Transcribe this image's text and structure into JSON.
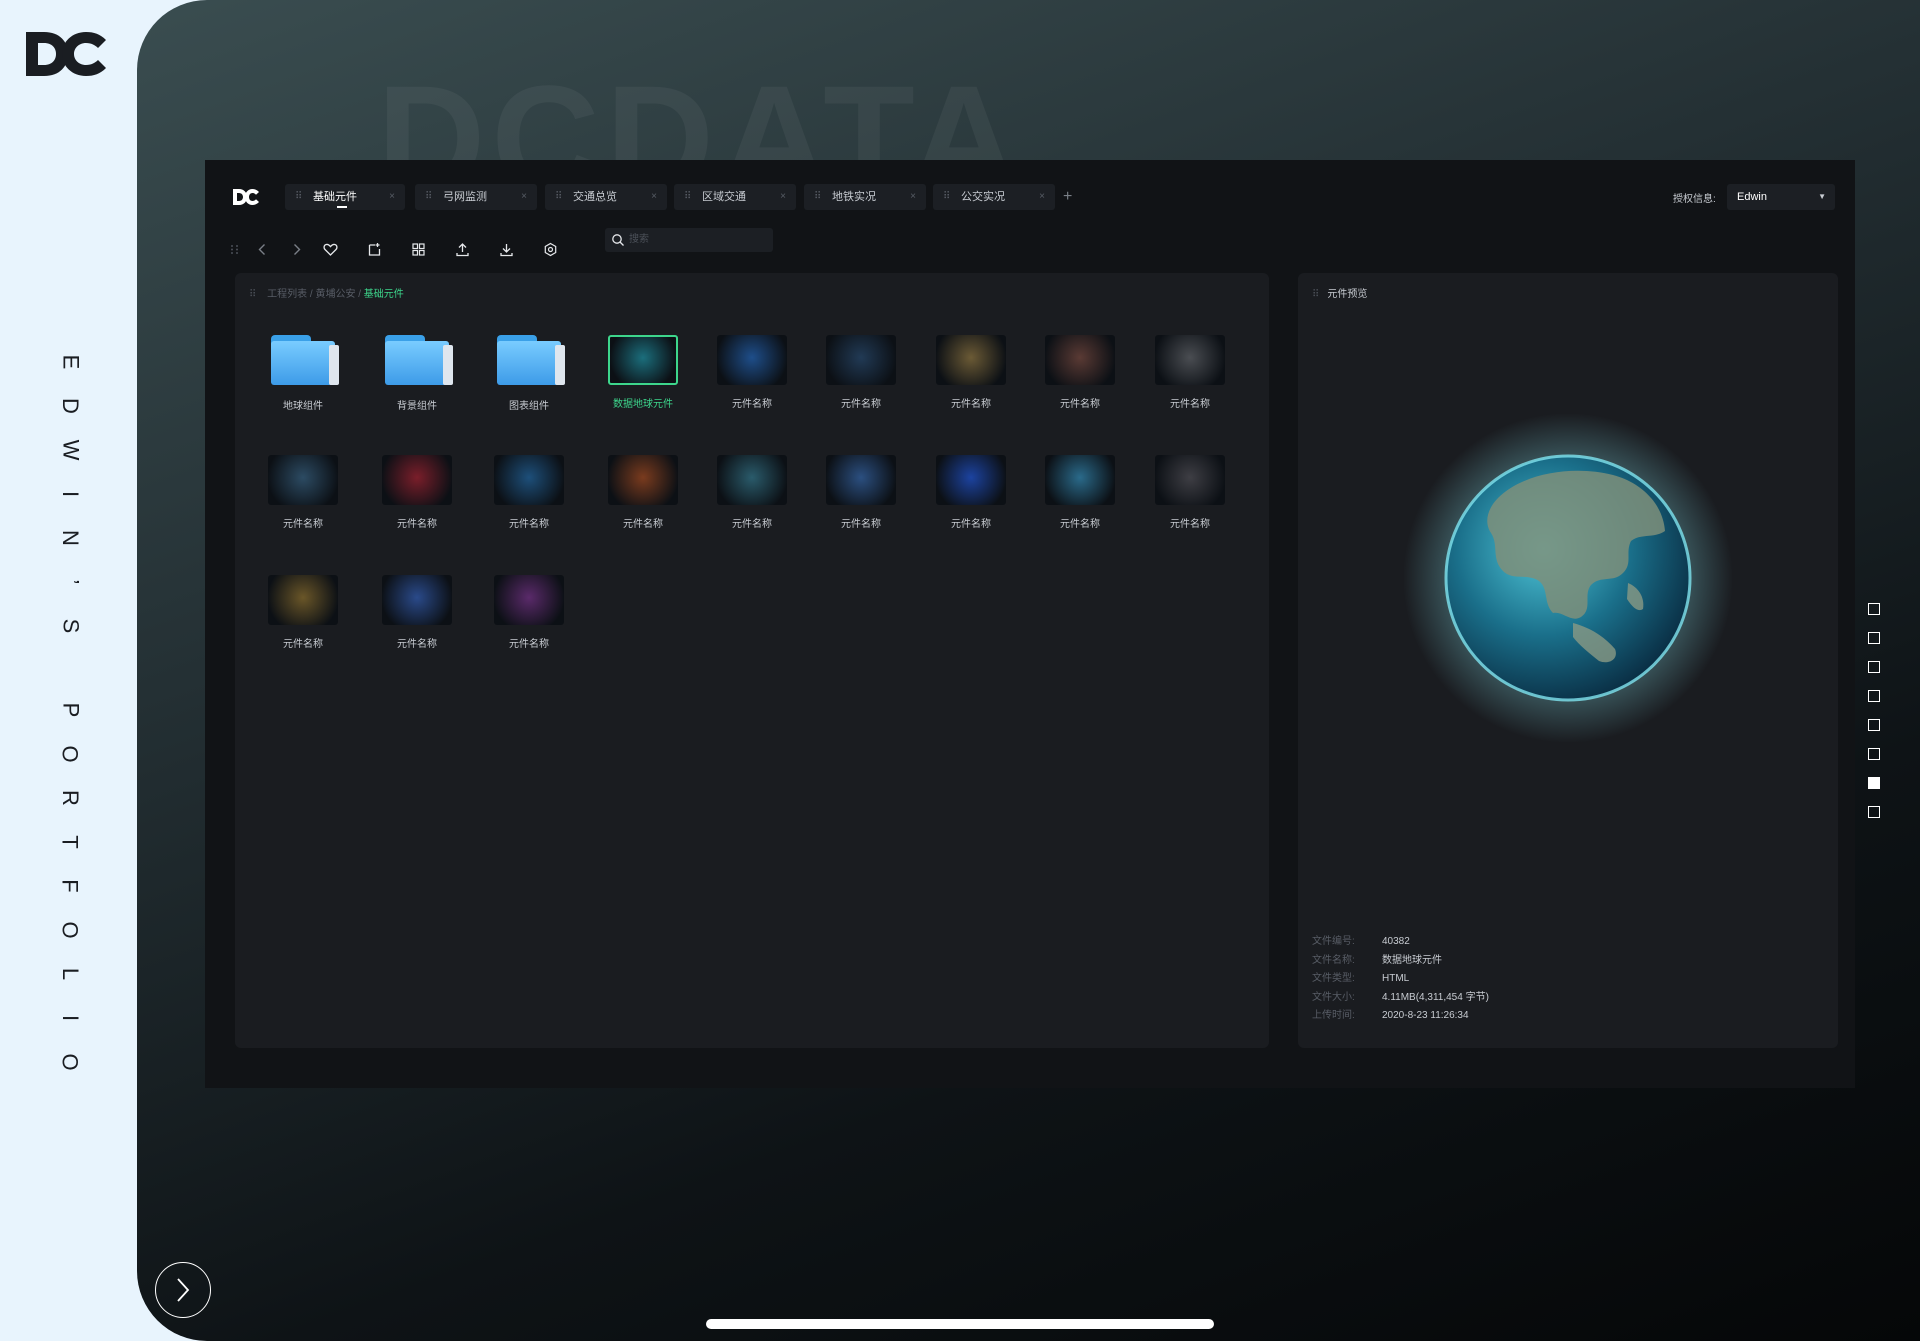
{
  "rail": {
    "letters": [
      "E",
      "D",
      "W",
      "I",
      "N",
      "’",
      "S",
      "",
      "P",
      "O",
      "R",
      "T",
      "F",
      "O",
      "L",
      "I",
      "O"
    ]
  },
  "background_word": "DCDATA",
  "tabs": [
    {
      "label": "基础元件",
      "active": true
    },
    {
      "label": "弓网监测",
      "active": false
    },
    {
      "label": "交通总览",
      "active": false
    },
    {
      "label": "区域交通",
      "active": false
    },
    {
      "label": "地铁实况",
      "active": false
    },
    {
      "label": "公交实况",
      "active": false
    }
  ],
  "tab_close": "×",
  "add_tab": "+",
  "auth": {
    "label": "授权信息:",
    "user": "Edwin"
  },
  "search": {
    "placeholder": "搜索"
  },
  "toolbar_icons": [
    "drag-handle-icon",
    "back-icon",
    "forward-icon",
    "favorite-icon",
    "new-file-icon",
    "grid-view-icon",
    "upload-icon",
    "download-icon",
    "settings-icon"
  ],
  "breadcrumb": {
    "root": "工程列表",
    "sep1": " / ",
    "mid": "黄埔公安",
    "sep2": " / ",
    "current": "基础元件"
  },
  "items": [
    {
      "label": "地球组件",
      "type": "folder"
    },
    {
      "label": "背景组件",
      "type": "folder"
    },
    {
      "label": "图表组件",
      "type": "folder"
    },
    {
      "label": "数据地球元件",
      "type": "thumb",
      "selected": true,
      "tone": "#1b6e7c"
    },
    {
      "label": "元件名称",
      "type": "thumb",
      "tone": "#1e4e8a"
    },
    {
      "label": "元件名称",
      "type": "thumb",
      "tone": "#213a55"
    },
    {
      "label": "元件名称",
      "type": "thumb",
      "tone": "#6b5a35"
    },
    {
      "label": "元件名称",
      "type": "thumb",
      "tone": "#5a3a34"
    },
    {
      "label": "元件名称",
      "type": "thumb",
      "tone": "#4a4d52"
    },
    {
      "label": "元件名称",
      "type": "thumb",
      "tone": "#2c4b63"
    },
    {
      "label": "元件名称",
      "type": "thumb",
      "tone": "#7a1e2a"
    },
    {
      "label": "元件名称",
      "type": "thumb",
      "tone": "#1d4f7a"
    },
    {
      "label": "元件名称",
      "type": "thumb",
      "tone": "#7a3b1e"
    },
    {
      "label": "元件名称",
      "type": "thumb",
      "tone": "#2a5b6b"
    },
    {
      "label": "元件名称",
      "type": "thumb",
      "tone": "#2b4f80"
    },
    {
      "label": "元件名称",
      "type": "thumb",
      "tone": "#1c43a0"
    },
    {
      "label": "元件名称",
      "type": "thumb",
      "tone": "#2a6a8a"
    },
    {
      "label": "元件名称",
      "type": "thumb",
      "tone": "#3e3e44"
    },
    {
      "label": "元件名称",
      "type": "thumb",
      "tone": "#6a5628"
    },
    {
      "label": "元件名称",
      "type": "thumb",
      "tone": "#2a4a8a"
    },
    {
      "label": "元件名称",
      "type": "thumb",
      "tone": "#5a2a6a"
    }
  ],
  "preview": {
    "title": "元件预览",
    "meta": [
      {
        "key": "文件编号:",
        "value": "40382"
      },
      {
        "key": "文件名称:",
        "value": "数据地球元件"
      },
      {
        "key": "文件类型:",
        "value": "HTML"
      },
      {
        "key": "文件大小:",
        "value": "4.11MB(4,311,454 字节)"
      },
      {
        "key": "上传时间:",
        "value": "2020-8-23  11:26:34"
      }
    ]
  },
  "pager": {
    "count": 8,
    "active_index": 6
  },
  "colors": {
    "accent": "#3dd68c",
    "panel": "#1a1c20",
    "app_bg": "#111316",
    "rail_bg": "#e8f4fd"
  }
}
